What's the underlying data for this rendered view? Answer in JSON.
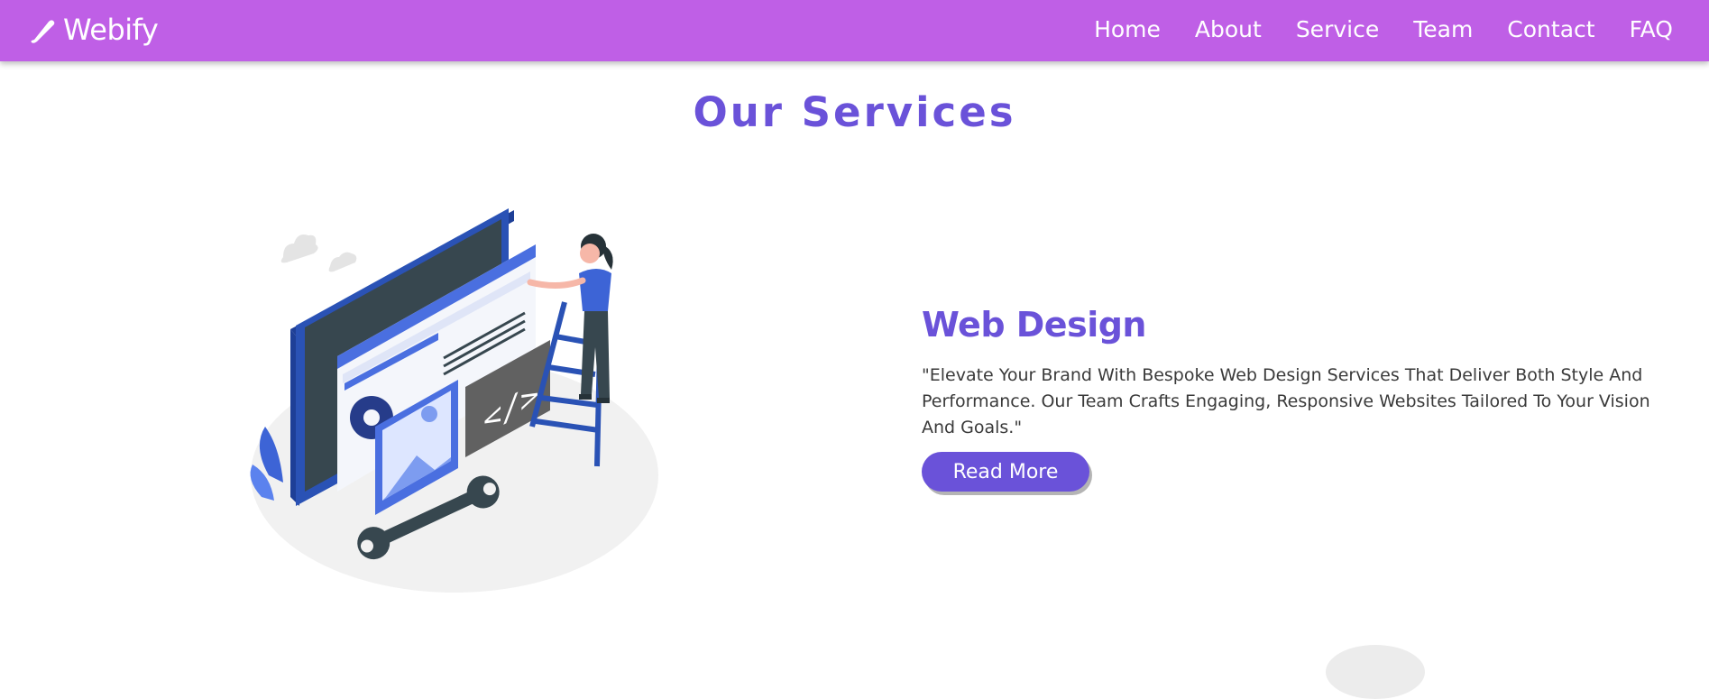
{
  "header": {
    "logo_text": "Webify",
    "logo_icon": "brush-icon",
    "nav": [
      {
        "label": "Home"
      },
      {
        "label": "About"
      },
      {
        "label": "Service"
      },
      {
        "label": "Team"
      },
      {
        "label": "Contact"
      },
      {
        "label": "FAQ"
      }
    ]
  },
  "section": {
    "title": "Our Services"
  },
  "service": {
    "title": "Web Design",
    "description": "\"Elevate Your Brand With Bespoke Web Design Services That Deliver Both Style And Performance. Our Team Crafts Engaging, Responsive Websites Tailored To Your Vision And Goals.\"",
    "button_label": "Read More",
    "illustration": "web-design-illustration"
  },
  "colors": {
    "header_bg": "#bf5fe6",
    "accent": "#6a52d9",
    "text": "#3a3a3a"
  }
}
